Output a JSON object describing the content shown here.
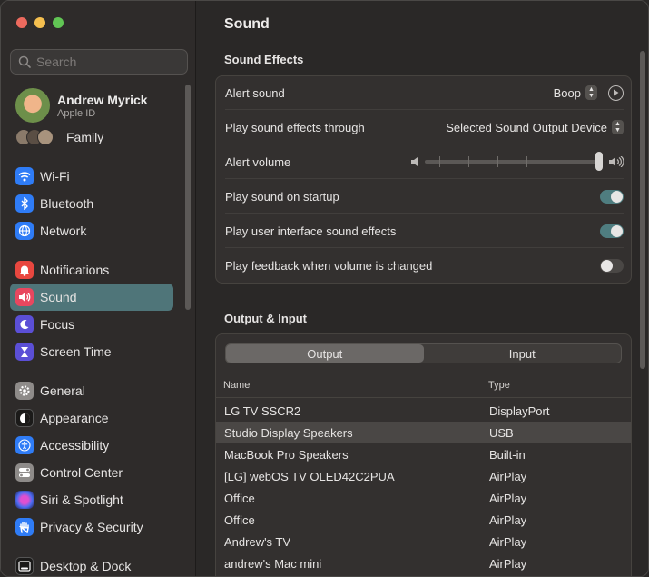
{
  "window": {
    "title": "Sound"
  },
  "sidebar": {
    "search_placeholder": "Search",
    "user": {
      "name": "Andrew Myrick",
      "subtitle": "Apple ID"
    },
    "family_label": "Family",
    "items": [
      {
        "label": "Wi-Fi",
        "icon": "wifi-icon",
        "color": "#2f7cf6"
      },
      {
        "label": "Bluetooth",
        "icon": "bluetooth-icon",
        "color": "#2f7cf6"
      },
      {
        "label": "Network",
        "icon": "globe-icon",
        "color": "#2f7cf6"
      },
      {
        "label": "Notifications",
        "icon": "bell-icon",
        "color": "#e8473f"
      },
      {
        "label": "Sound",
        "icon": "speaker-icon",
        "color": "#e8475f",
        "active": true
      },
      {
        "label": "Focus",
        "icon": "moon-icon",
        "color": "#5b4fd6"
      },
      {
        "label": "Screen Time",
        "icon": "hourglass-icon",
        "color": "#5b4fd6"
      },
      {
        "label": "General",
        "icon": "gear-icon",
        "color": "#8e8b89"
      },
      {
        "label": "Appearance",
        "icon": "appearance-icon",
        "color": "#1b1a19"
      },
      {
        "label": "Accessibility",
        "icon": "accessibility-icon",
        "color": "#2f7cf6"
      },
      {
        "label": "Control Center",
        "icon": "control-center-icon",
        "color": "#8e8b89"
      },
      {
        "label": "Siri & Spotlight",
        "icon": "siri-icon",
        "color": "#3a2f6b"
      },
      {
        "label": "Privacy & Security",
        "icon": "hand-icon",
        "color": "#2f7cf6"
      },
      {
        "label": "Desktop & Dock",
        "icon": "dock-icon",
        "color": "#1b1a19"
      }
    ]
  },
  "sound_effects": {
    "section_title": "Sound Effects",
    "alert_sound": {
      "label": "Alert sound",
      "value": "Boop"
    },
    "output_device": {
      "label": "Play sound effects through",
      "value": "Selected Sound Output Device"
    },
    "alert_volume": {
      "label": "Alert volume",
      "level": 1.0
    },
    "startup": {
      "label": "Play sound on startup",
      "on": true
    },
    "ui_effects": {
      "label": "Play user interface sound effects",
      "on": true
    },
    "feedback": {
      "label": "Play feedback when volume is changed",
      "on": false
    }
  },
  "output_input": {
    "section_title": "Output & Input",
    "tabs": [
      "Output",
      "Input"
    ],
    "selected_tab": "Output",
    "columns": [
      "Name",
      "Type"
    ],
    "devices": [
      {
        "name": "LG TV SSCR2",
        "type": "DisplayPort"
      },
      {
        "name": "Studio Display Speakers",
        "type": "USB",
        "selected": true
      },
      {
        "name": "MacBook Pro Speakers",
        "type": "Built-in"
      },
      {
        "name": "[LG] webOS TV OLED42C2PUA",
        "type": "AirPlay"
      },
      {
        "name": "Office",
        "type": "AirPlay"
      },
      {
        "name": "Office",
        "type": "AirPlay"
      },
      {
        "name": "Andrew's TV",
        "type": "AirPlay"
      },
      {
        "name": "andrew's Mac mini",
        "type": "AirPlay"
      }
    ]
  }
}
